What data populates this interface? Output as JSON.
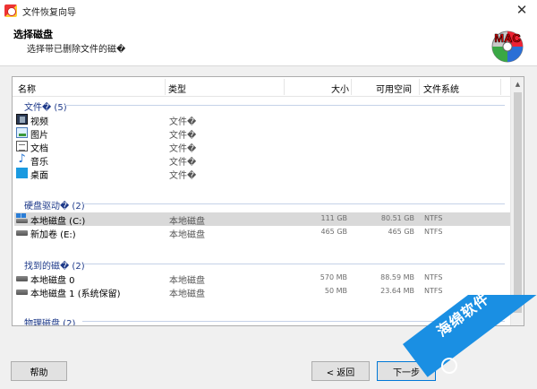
{
  "window": {
    "title": "文件恢复向导",
    "close_glyph": "✕"
  },
  "header": {
    "title": "选择磁盘",
    "subtitle": "选择带已删除文件的磁�",
    "logo_text": "MAC"
  },
  "columns": {
    "name": "名称",
    "type": "类型",
    "size": "大小",
    "free": "可用空间",
    "fs": "文件系统"
  },
  "groups": [
    {
      "title": "文件� (5)",
      "items": [
        {
          "icon": "video-folder-icon",
          "name": "视频",
          "type": "文件�",
          "size": "",
          "free": "",
          "fs": ""
        },
        {
          "icon": "pictures-folder-icon",
          "name": "图片",
          "type": "文件�",
          "size": "",
          "free": "",
          "fs": ""
        },
        {
          "icon": "documents-folder-icon",
          "name": "文档",
          "type": "文件�",
          "size": "",
          "free": "",
          "fs": ""
        },
        {
          "icon": "music-folder-icon",
          "name": "音乐",
          "type": "文件�",
          "size": "",
          "free": "",
          "fs": ""
        },
        {
          "icon": "desktop-folder-icon",
          "name": "桌面",
          "type": "文件�",
          "size": "",
          "free": "",
          "fs": ""
        }
      ]
    },
    {
      "title": "硬盘驱动� (2)",
      "items": [
        {
          "icon": "system-drive-icon",
          "name": "本地磁盘 (C:)",
          "type": "本地磁盘",
          "size": "111 GB",
          "free": "80.51 GB",
          "fs": "NTFS",
          "selected": true
        },
        {
          "icon": "drive-icon",
          "name": "新加卷 (E:)",
          "type": "本地磁盘",
          "size": "465 GB",
          "free": "465 GB",
          "fs": "NTFS"
        }
      ]
    },
    {
      "title": "找到的磁� (2)",
      "items": [
        {
          "icon": "drive-icon",
          "name": "本地磁盘 0",
          "type": "本地磁盘",
          "size": "570 MB",
          "free": "88.59 MB",
          "fs": "NTFS"
        },
        {
          "icon": "drive-icon",
          "name": "本地磁盘 1 (系统保留)",
          "type": "本地磁盘",
          "size": "50 MB",
          "free": "23.64 MB",
          "fs": "NTFS"
        }
      ]
    },
    {
      "title": "物理磁盘 (2)",
      "items": []
    }
  ],
  "buttons": {
    "help": "帮助",
    "back": "< 返回",
    "next": "下一步"
  },
  "watermark": {
    "text": "海绵软件"
  },
  "colors": {
    "group_title": "#1e3a8a",
    "selection": "#d9d9d9",
    "watermark": "#1a8fe3"
  }
}
